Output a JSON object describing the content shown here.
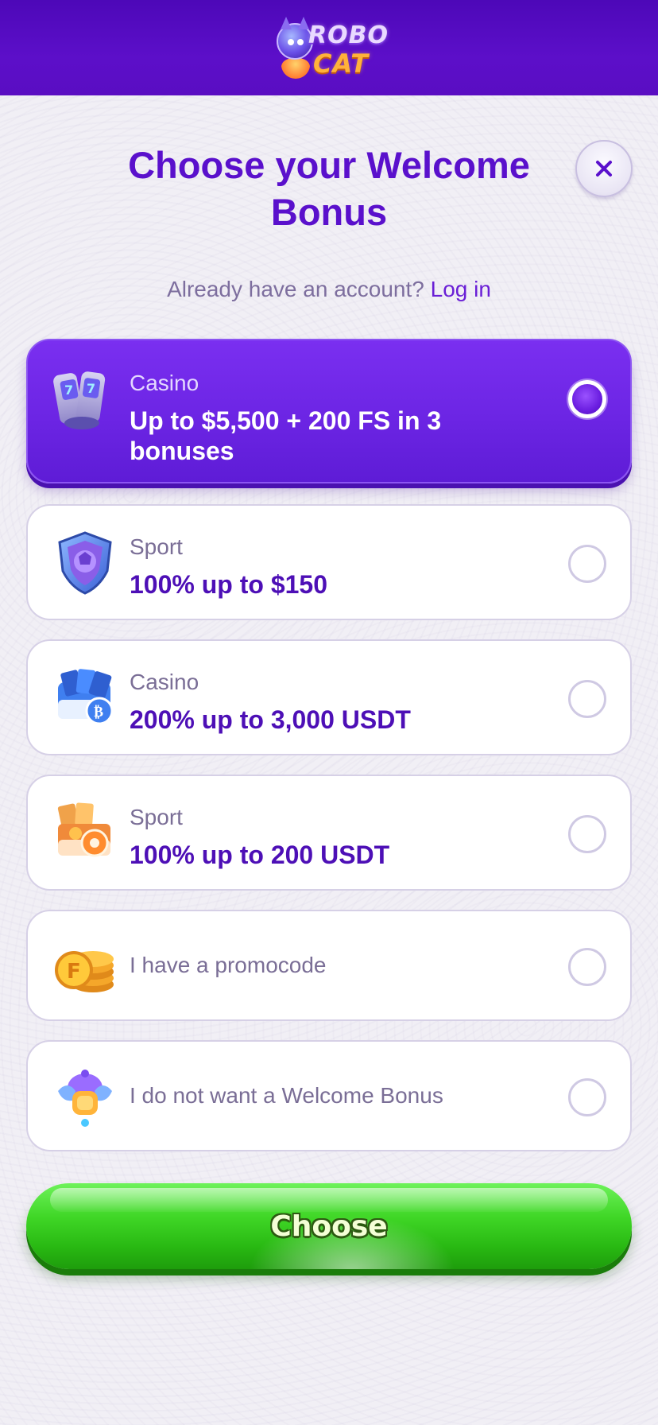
{
  "header": {
    "logo_top": "ROBO",
    "logo_bottom": "CAT"
  },
  "title": "Choose your Welcome Bonus",
  "account": {
    "prompt": "Already have an account?",
    "login_label": "Log in"
  },
  "bonuses": [
    {
      "category": "Casino",
      "offer": "Up to $5,500 + 200 FS in 3 bonuses",
      "icon": "slot-machine-icon",
      "selected": true
    },
    {
      "category": "Sport",
      "offer": "100% up to $150",
      "icon": "shield-ball-icon",
      "selected": false
    },
    {
      "category": "Casino",
      "offer": "200% up to 3,000 USDT",
      "icon": "bitcoin-cards-icon",
      "selected": false
    },
    {
      "category": "Sport",
      "offer": "100% up to 200 USDT",
      "icon": "sport-crypto-box-icon",
      "selected": false
    },
    {
      "label": "I have a promocode",
      "icon": "coin-stack-icon",
      "selected": false
    },
    {
      "label": "I do not want a Welcome Bonus",
      "icon": "robot-pod-icon",
      "selected": false
    }
  ],
  "choose_label": "Choose",
  "colors": {
    "header_purple": "#5a0dc2",
    "title_purple": "#5a10cc",
    "selected_card": "#6c25e4",
    "button_green": "#3fd626"
  }
}
